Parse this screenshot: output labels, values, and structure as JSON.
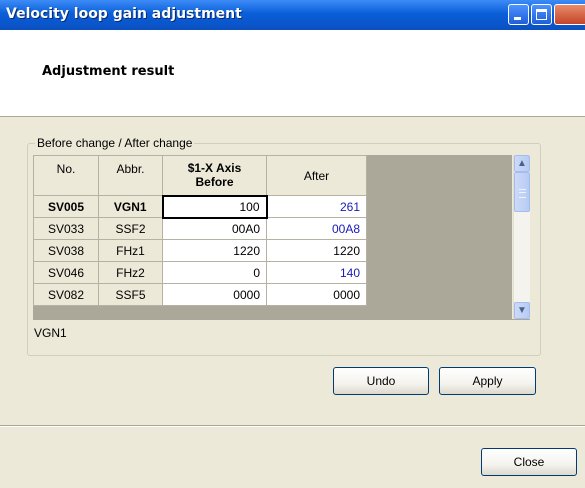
{
  "window": {
    "title": "Velocity loop gain adjustment"
  },
  "header": {
    "title": "Adjustment result"
  },
  "group": {
    "legend": "Before change / After change"
  },
  "grid": {
    "columns": {
      "no": "No.",
      "abbr": "Abbr.",
      "before_line1": "$1-X Axis",
      "before_line2": "Before",
      "after": "After"
    },
    "rows": [
      {
        "no": "SV005",
        "abbr": "VGN1",
        "before": "100",
        "after": "261"
      },
      {
        "no": "SV033",
        "abbr": "SSF2",
        "before": "00A0",
        "after": "00A8"
      },
      {
        "no": "SV038",
        "abbr": "FHz1",
        "before": "1220",
        "after": "1220"
      },
      {
        "no": "SV046",
        "abbr": "FHz2",
        "before": "0",
        "after": "140"
      },
      {
        "no": "SV082",
        "abbr": "SSF5",
        "before": "0000",
        "after": "0000"
      }
    ],
    "selected_row": 0
  },
  "status": {
    "text": "VGN1"
  },
  "buttons": {
    "undo": "Undo",
    "apply": "Apply",
    "close": "Close"
  },
  "colors": {
    "changed_value": "#1a1ab8",
    "titlebar": "#0a5fd8"
  },
  "icons": {
    "scroll_up": "▲",
    "scroll_down": "▼"
  }
}
